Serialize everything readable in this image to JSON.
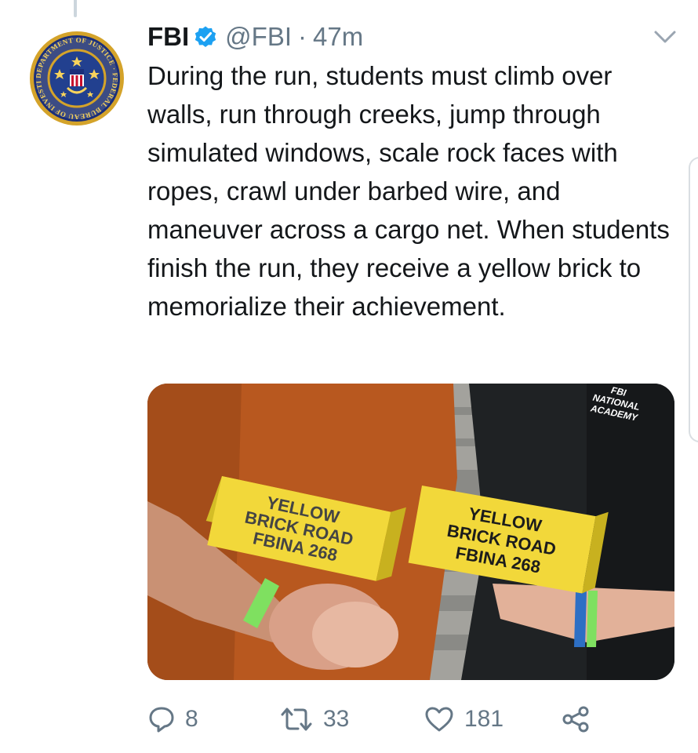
{
  "tweet": {
    "author": {
      "display_name": "FBI",
      "handle": "@FBI",
      "verified": true
    },
    "separator": "·",
    "time": "47m",
    "text": "During the run, students must climb over walls, run through creeks, jump through simulated windows, scale rock faces with ropes, crawl under barbed wire, and maneuver across a cargo net. When students finish the run, they receive a yellow brick to memorialize their achievement.",
    "avatar_seal": {
      "ring_text": "DEPARTMENT OF JUSTICE · FEDERAL BUREAU OF INVESTIGATION"
    },
    "media": {
      "brick_left": [
        "YELLOW",
        "BRICK ROAD",
        "FBINA 268"
      ],
      "brick_right": [
        "YELLOW",
        "BRICK ROAD",
        "FBINA 268"
      ],
      "shirt_logo": [
        "FBI",
        "NATIONAL",
        "ACADEMY"
      ]
    },
    "actions": {
      "replies": "8",
      "retweets": "33",
      "likes": "181"
    }
  },
  "colors": {
    "text": "#14171a",
    "secondary": "#657786",
    "verified_blue": "#1da1f2",
    "brick_yellow": "#f2d83a",
    "seal_gold": "#d4a32a",
    "seal_blue": "#1b2f7a"
  },
  "icons": {
    "verified": "verified-badge-icon",
    "caret": "chevron-down-icon",
    "reply": "reply-icon",
    "retweet": "retweet-icon",
    "like": "heart-icon",
    "share": "share-icon"
  }
}
